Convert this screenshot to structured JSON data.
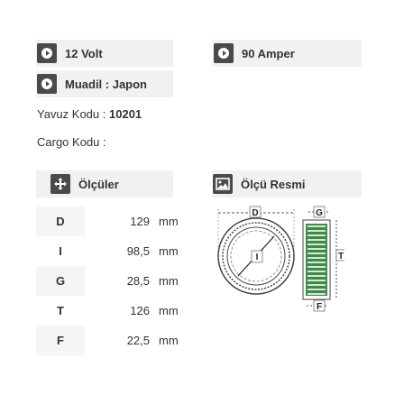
{
  "specs": {
    "voltage": "12 Volt",
    "amperage": "90 Amper",
    "equivalent": "Muadil : Japon",
    "yavuz_code_label": "Yavuz Kodu :",
    "yavuz_code_value": "10201",
    "cargo_code_label": "Cargo Kodu :"
  },
  "sections": {
    "measurements_title": "Ölçüler",
    "measurements_icon": "move-arrows-icon",
    "drawing_title": "Ölçü Resmi",
    "drawing_icon": "image-icon"
  },
  "measurements": [
    {
      "key": "D",
      "value": "129",
      "unit": "mm"
    },
    {
      "key": "I",
      "value": "98,5",
      "unit": "mm"
    },
    {
      "key": "G",
      "value": "28,5",
      "unit": "mm"
    },
    {
      "key": "T",
      "value": "126",
      "unit": "mm"
    },
    {
      "key": "F",
      "value": "22,5",
      "unit": "mm"
    }
  ],
  "drawing_labels": {
    "d": "D",
    "i": "I",
    "g": "G",
    "t": "T",
    "f": "F"
  },
  "colors": {
    "icon_bg": "#4a4a4a",
    "box_bg": "#f1f1f1",
    "diagram_green": "#3f8a4a"
  }
}
